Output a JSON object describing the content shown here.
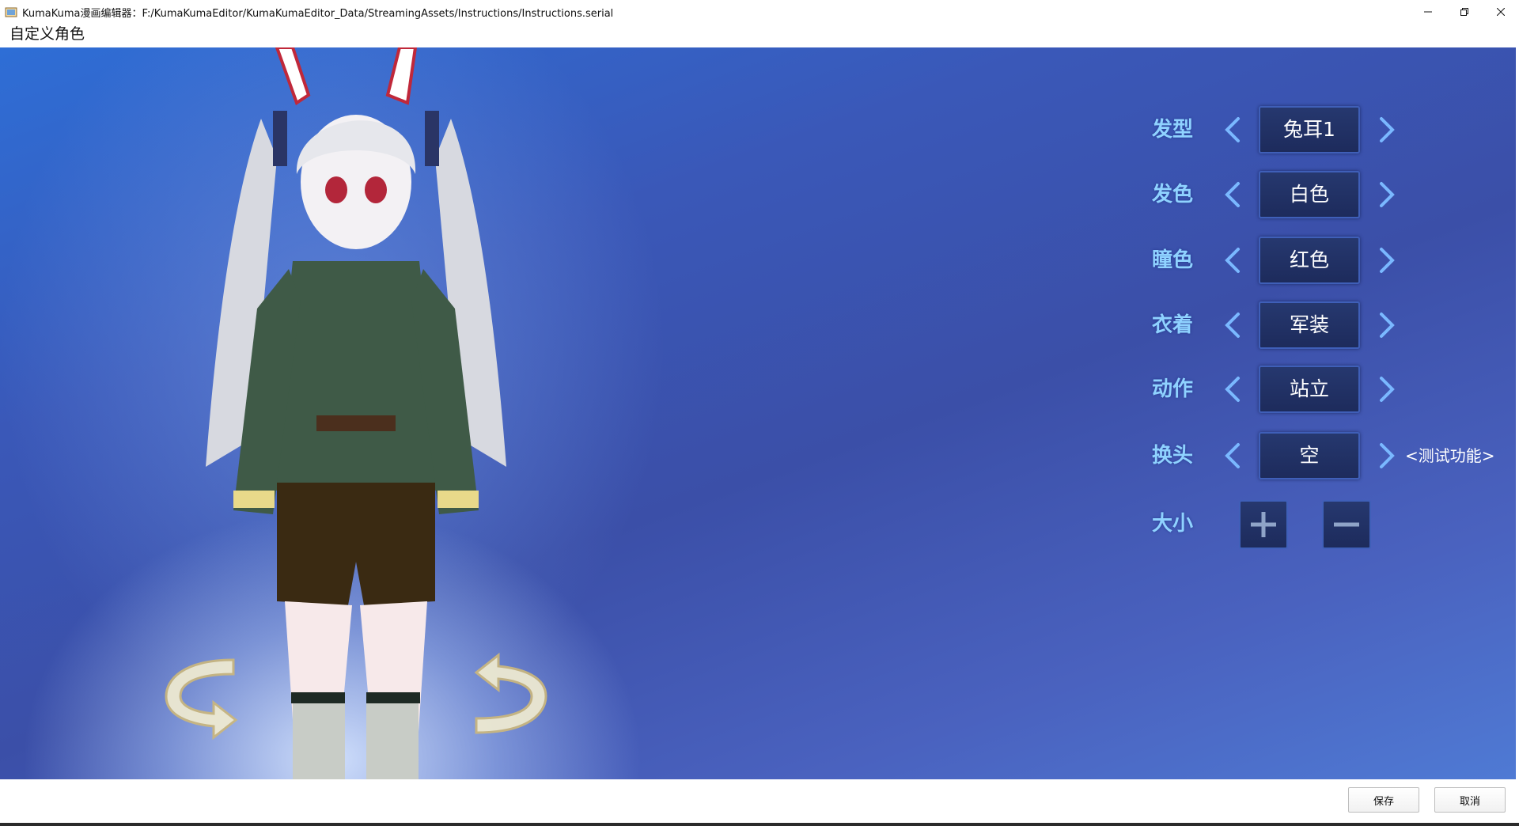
{
  "window": {
    "title": "KumaKuma漫画编辑器：F:/KumaKumaEditor/KumaKumaEditor_Data/StreamingAssets/Instructions/Instructions.serial",
    "controls": [
      "minimize-icon",
      "restore-icon",
      "close-icon"
    ]
  },
  "page": {
    "title": "自定义角色"
  },
  "options": [
    {
      "label": "发型",
      "value": "兔耳1"
    },
    {
      "label": "发色",
      "value": "白色"
    },
    {
      "label": "瞳色",
      "value": "红色"
    },
    {
      "label": "衣着",
      "value": "军装"
    },
    {
      "label": "动作",
      "value": "站立"
    },
    {
      "label": "换头",
      "value": "空",
      "note": "<测试功能>"
    }
  ],
  "size": {
    "label": "大小",
    "increase_icon": "plus-icon",
    "decrease_icon": "minus-icon"
  },
  "footer": {
    "save_label": "保存",
    "cancel_label": "取消"
  },
  "colors": {
    "label": "#8fd2ff",
    "value_box": "#1d2b5c",
    "value_border": "#3f5fb8",
    "arrow": "#7ab8ff",
    "stage_bg": "#3b4fa8"
  }
}
